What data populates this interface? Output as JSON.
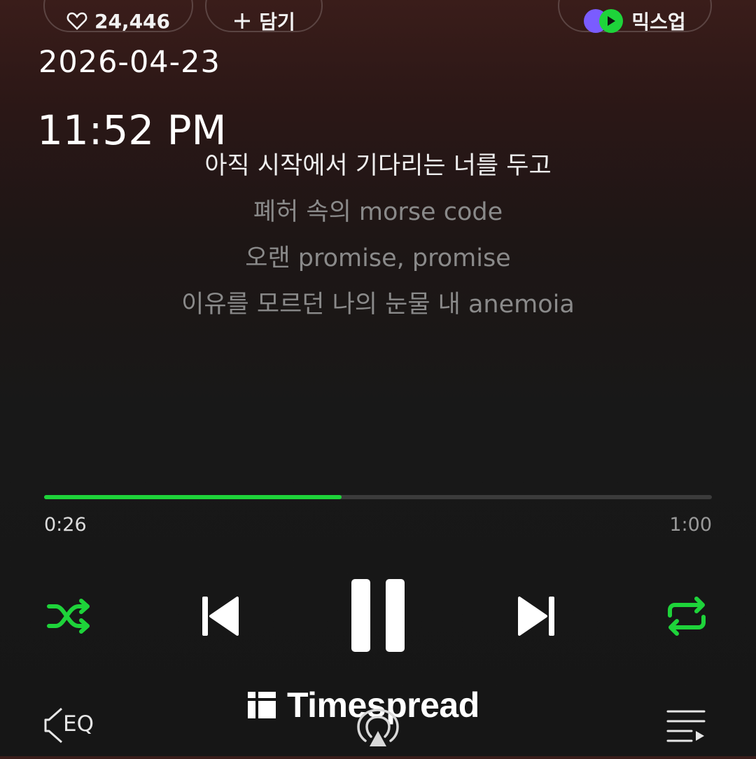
{
  "header": {
    "like_count": "24,446",
    "add_label": "담기",
    "mix_label": "믹스업",
    "icons": {
      "like": "heart-icon",
      "add": "plus-icon",
      "mix": "mixup-logo-icon"
    }
  },
  "overlay": {
    "date": "2026-04-23",
    "time": "11:52 PM"
  },
  "lyrics": [
    "아직 시작에서 기다리는 너를 두고",
    "폐허 속의 morse code",
    "오랜 promise, promise",
    "이유를 모르던 나의 눈물 내 anemoia"
  ],
  "active_lyric_index": 0,
  "playback": {
    "current_time": "0:26",
    "total_time": "1:00",
    "progress_fraction": 0.445,
    "state": "playing"
  },
  "controls": {
    "shuffle": "shuffle-icon",
    "previous": "previous-track-icon",
    "pause": "pause-icon",
    "next": "next-track-icon",
    "repeat": "repeat-icon"
  },
  "bottom_bar": {
    "eq_label": "EQ",
    "icons": {
      "eq": "eq-speaker-icon",
      "cast": "cast-icon",
      "playlist": "playlist-icon"
    }
  },
  "watermark": {
    "text": "Timespread"
  },
  "colors": {
    "accent": "#1ed33a",
    "background_top": "#3a1d1a",
    "background_bottom": "#161616",
    "lyric_dim": "#8a8a8a"
  }
}
